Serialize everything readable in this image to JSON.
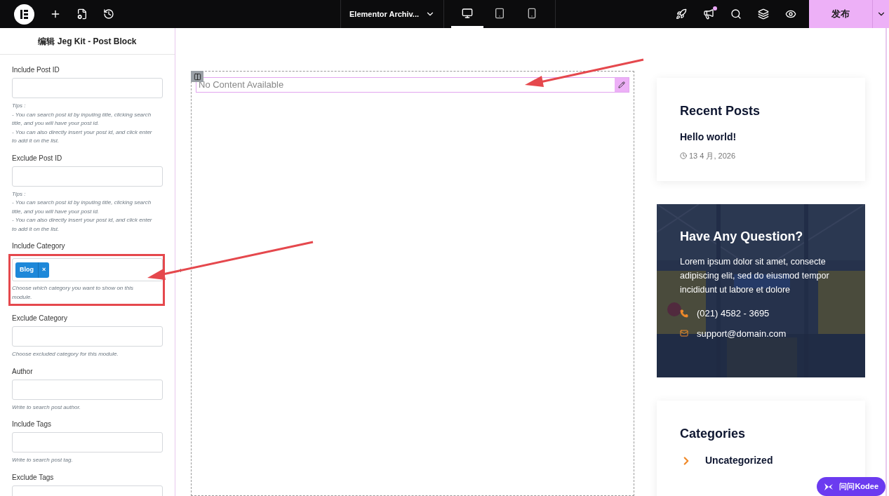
{
  "topbar": {
    "document_title": "Elementor Archiv...",
    "devices": [
      {
        "kind": "desktop",
        "selected": true
      },
      {
        "kind": "tablet",
        "selected": false
      },
      {
        "kind": "mobile",
        "selected": false
      }
    ],
    "notification_dot": true,
    "publish_label": "发布"
  },
  "panel": {
    "title": "编辑 Jeg Kit - Post Block",
    "controls": [
      {
        "kind": "input",
        "label": "Include Post ID",
        "tips": [
          "Tips :",
          "- You can search post id by inputing title, clicking search title, and you will have your post id.",
          "- You can also directly insert your post id, and click enter to add it on the list."
        ]
      },
      {
        "kind": "input",
        "label": "Exclude Post ID",
        "tips": [
          "Tips :",
          "- You can search post id by inputing title, clicking search title, and you will have your post id.",
          "- You can also directly insert your post id, and click enter to add it on the list."
        ]
      },
      {
        "kind": "tags",
        "label": "Include Category",
        "tags": [
          {
            "label": "Blog",
            "remove": "×"
          }
        ],
        "tips": [
          "Choose which category you want to show on this module."
        ]
      },
      {
        "kind": "input",
        "label": "Exclude Category",
        "tips": [
          "Choose excluded category for this module."
        ]
      },
      {
        "kind": "input",
        "label": "Author",
        "tips": [
          "Write to search post author."
        ]
      },
      {
        "kind": "input",
        "label": "Include Tags",
        "tips": [
          "Write to search post tag."
        ]
      },
      {
        "kind": "input",
        "label": "Exclude Tags"
      }
    ]
  },
  "canvas": {
    "widget_text": "No Content Available",
    "recent_posts": {
      "title": "Recent Posts",
      "post_title": "Hello world!",
      "date": "13 4 月, 2026"
    },
    "question": {
      "title": "Have Any Question?",
      "body": "Lorem ipsum dolor sit amet, consecte adipiscing elit, sed do eiusmod tempor incididunt ut labore et dolore",
      "phone": "(021) 4582 - 3695",
      "email": "support@domain.com"
    },
    "categories": {
      "title": "Categories",
      "items": [
        "Uncategorized"
      ]
    }
  },
  "assistant_button": "问问Kodee"
}
